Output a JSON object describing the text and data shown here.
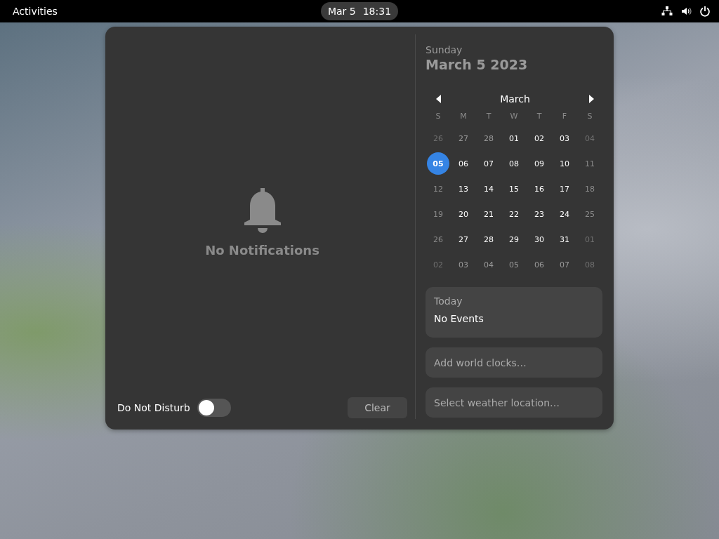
{
  "top_bar": {
    "activities": "Activities",
    "clock": {
      "date": "Mar 5",
      "time": "18:31"
    }
  },
  "notifications": {
    "empty_message": "No Notifications",
    "do_not_disturb": {
      "label": "Do Not Disturb",
      "on": false
    },
    "clear_button": "Clear"
  },
  "calendar": {
    "weekday": "Sunday",
    "date": "March 5 2023",
    "month": "March",
    "day_headers": [
      "S",
      "M",
      "T",
      "W",
      "T",
      "F",
      "S"
    ],
    "days": [
      {
        "label": "26",
        "kind": "faded",
        "selected": false
      },
      {
        "label": "27",
        "kind": "outside",
        "selected": false
      },
      {
        "label": "28",
        "kind": "outside",
        "selected": false
      },
      {
        "label": "01",
        "kind": "weekday",
        "selected": false
      },
      {
        "label": "02",
        "kind": "weekday",
        "selected": false
      },
      {
        "label": "03",
        "kind": "weekday",
        "selected": false
      },
      {
        "label": "04",
        "kind": "faded",
        "selected": false
      },
      {
        "label": "05",
        "kind": "weekend",
        "selected": true
      },
      {
        "label": "06",
        "kind": "weekday",
        "selected": false
      },
      {
        "label": "07",
        "kind": "weekday",
        "selected": false
      },
      {
        "label": "08",
        "kind": "weekday",
        "selected": false
      },
      {
        "label": "09",
        "kind": "weekday",
        "selected": false
      },
      {
        "label": "10",
        "kind": "weekday",
        "selected": false
      },
      {
        "label": "11",
        "kind": "weekend",
        "selected": false
      },
      {
        "label": "12",
        "kind": "weekend",
        "selected": false
      },
      {
        "label": "13",
        "kind": "weekday",
        "selected": false
      },
      {
        "label": "14",
        "kind": "weekday",
        "selected": false
      },
      {
        "label": "15",
        "kind": "weekday",
        "selected": false
      },
      {
        "label": "16",
        "kind": "weekday",
        "selected": false
      },
      {
        "label": "17",
        "kind": "weekday",
        "selected": false
      },
      {
        "label": "18",
        "kind": "weekend",
        "selected": false
      },
      {
        "label": "19",
        "kind": "weekend",
        "selected": false
      },
      {
        "label": "20",
        "kind": "weekday",
        "selected": false
      },
      {
        "label": "21",
        "kind": "weekday",
        "selected": false
      },
      {
        "label": "22",
        "kind": "weekday",
        "selected": false
      },
      {
        "label": "23",
        "kind": "weekday",
        "selected": false
      },
      {
        "label": "24",
        "kind": "weekday",
        "selected": false
      },
      {
        "label": "25",
        "kind": "weekend",
        "selected": false
      },
      {
        "label": "26",
        "kind": "weekend",
        "selected": false
      },
      {
        "label": "27",
        "kind": "weekday",
        "selected": false
      },
      {
        "label": "28",
        "kind": "weekday",
        "selected": false
      },
      {
        "label": "29",
        "kind": "weekday",
        "selected": false
      },
      {
        "label": "30",
        "kind": "weekday",
        "selected": false
      },
      {
        "label": "31",
        "kind": "weekday",
        "selected": false
      },
      {
        "label": "01",
        "kind": "faded",
        "selected": false
      },
      {
        "label": "02",
        "kind": "faded",
        "selected": false
      },
      {
        "label": "03",
        "kind": "outside",
        "selected": false
      },
      {
        "label": "04",
        "kind": "outside",
        "selected": false
      },
      {
        "label": "05",
        "kind": "outside",
        "selected": false
      },
      {
        "label": "06",
        "kind": "outside",
        "selected": false
      },
      {
        "label": "07",
        "kind": "outside",
        "selected": false
      },
      {
        "label": "08",
        "kind": "faded",
        "selected": false
      }
    ]
  },
  "events": {
    "heading": "Today",
    "text": "No Events"
  },
  "world_clocks": "Add world clocks…",
  "weather": "Select weather location…"
}
